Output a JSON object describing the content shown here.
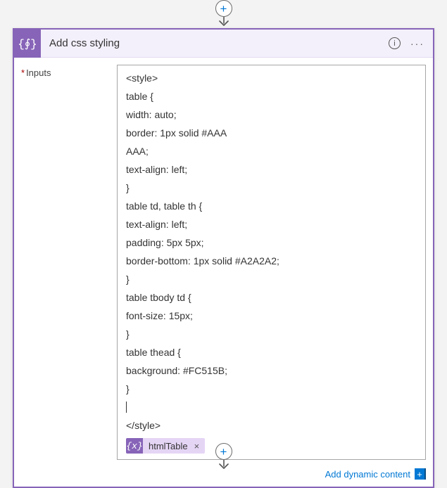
{
  "action": {
    "title": "Add css styling",
    "input_label": "Inputs"
  },
  "code_lines": [
    "<style>",
    "table {",
    "width: auto;",
    "border: 1px solid #AAA",
    "AAA;",
    "text-align: left;",
    "}",
    "table td, table th {",
    "text-align: left;",
    "padding: 5px 5px;",
    "border-bottom: 1px solid #A2A2A2;",
    "}",
    "table tbody td {",
    "font-size: 15px;",
    "}",
    "table thead {",
    "background: #FC515B;",
    "}"
  ],
  "closing_line": "</style>",
  "token": {
    "name": "htmlTable",
    "icon_glyph": "{x}"
  },
  "footer": {
    "add_dynamic": "Add dynamic content"
  },
  "glyphs": {
    "brace": "{∮}",
    "info": "i",
    "plus": "+",
    "close": "×",
    "ellipsis": "···"
  }
}
